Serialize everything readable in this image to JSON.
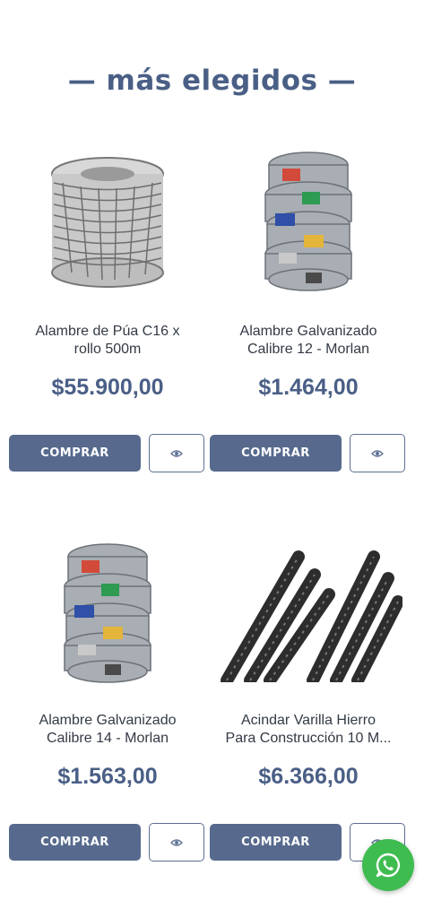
{
  "section": {
    "title": "— más elegidos —"
  },
  "products": [
    {
      "name_line1": "Alambre de Púa C16 x",
      "name_line2": "rollo 500m",
      "price": "$55.900,00",
      "buy_label": "COMPRAR",
      "image": "barbed-wire-roll"
    },
    {
      "name_line1": "Alambre Galvanizado",
      "name_line2": "Calibre 12 - Morlan",
      "price": "$1.464,00",
      "buy_label": "COMPRAR",
      "image": "galvanized-wire-coils"
    },
    {
      "name_line1": "Alambre Galvanizado",
      "name_line2": "Calibre 14 - Morlan",
      "price": "$1.563,00",
      "buy_label": "COMPRAR",
      "image": "galvanized-wire-coils"
    },
    {
      "name_line1": "Acindar Varilla Hierro",
      "name_line2": "Para Construcción 10 M...",
      "price": "$6.366,00",
      "buy_label": "COMPRAR",
      "image": "rebar-bars"
    }
  ],
  "icons": {
    "view": "eye-icon",
    "chat": "whatsapp-icon"
  },
  "colors": {
    "accent": "#4a5f86",
    "button": "#576a8e",
    "whatsapp": "#3fbc50"
  }
}
